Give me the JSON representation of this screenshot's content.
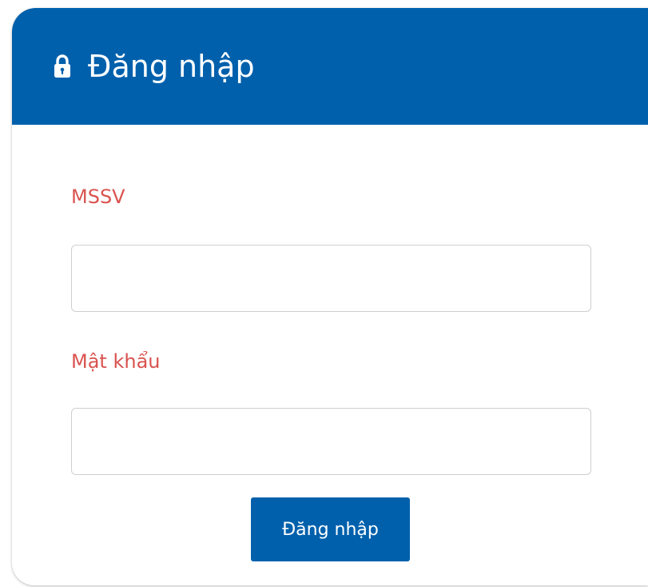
{
  "login_card": {
    "title": "Đăng nhập",
    "lock_icon": "lock-icon",
    "mssv_label": "MSSV",
    "mssv_value": "",
    "password_label": "Mật khẩu",
    "password_value": "",
    "submit_label": "Đăng nhập"
  },
  "colors": {
    "header_background": "#0060ac",
    "label_text": "#d9534f",
    "button_background": "#0060ac",
    "input_border": "#cfcfcf",
    "page_background": "#ffffff"
  }
}
